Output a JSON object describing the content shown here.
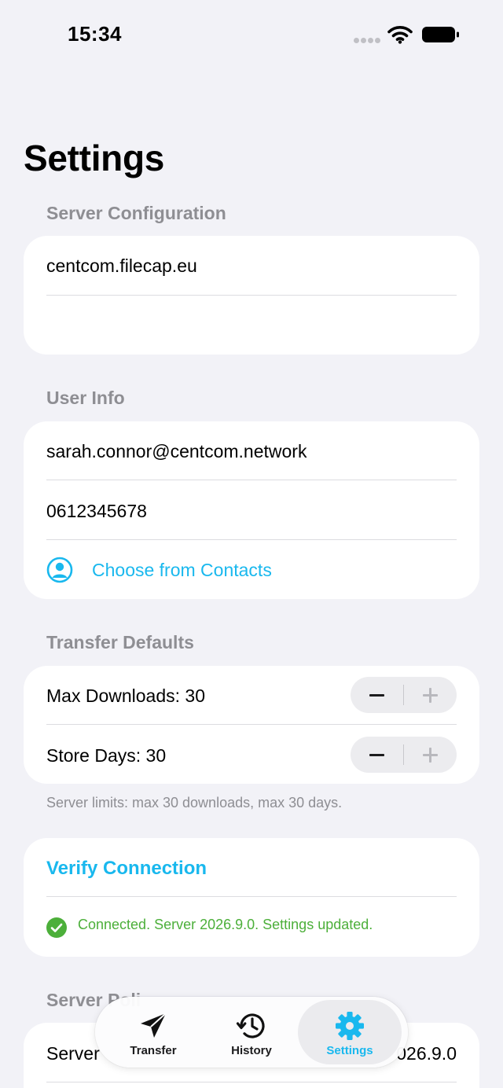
{
  "status_bar": {
    "time": "15:34"
  },
  "page": {
    "title": "Settings"
  },
  "server_config": {
    "header": "Server Configuration",
    "server_value": "centcom.filecap.eu",
    "second_value": ""
  },
  "user_info": {
    "header": "User Info",
    "email": "sarah.connor@centcom.network",
    "phone": "0612345678",
    "choose_contacts": "Choose from Contacts"
  },
  "transfer_defaults": {
    "header": "Transfer Defaults",
    "max_downloads": "Max Downloads: 30",
    "store_days": "Store Days: 30",
    "footnote": "Server limits: max 30 downloads, max 30 days."
  },
  "verify": {
    "button_label": "Verify Connection",
    "status": "Connected. Server 2026.9.0. Settings updated."
  },
  "server_policy": {
    "header_partial": "Server Poli",
    "row_label_partial": "Server",
    "row_value_partial": "026.9.0"
  },
  "tab_bar": {
    "tabs": [
      {
        "label": "Transfer",
        "icon": "paperplane-icon"
      },
      {
        "label": "History",
        "icon": "clock-history-icon"
      },
      {
        "label": "Settings",
        "icon": "gear-icon",
        "active": true
      }
    ]
  },
  "colors": {
    "accent": "#19b8ee",
    "success": "#4caf3a",
    "background": "#f2f2f7",
    "secondary_text": "#8e8e93"
  }
}
